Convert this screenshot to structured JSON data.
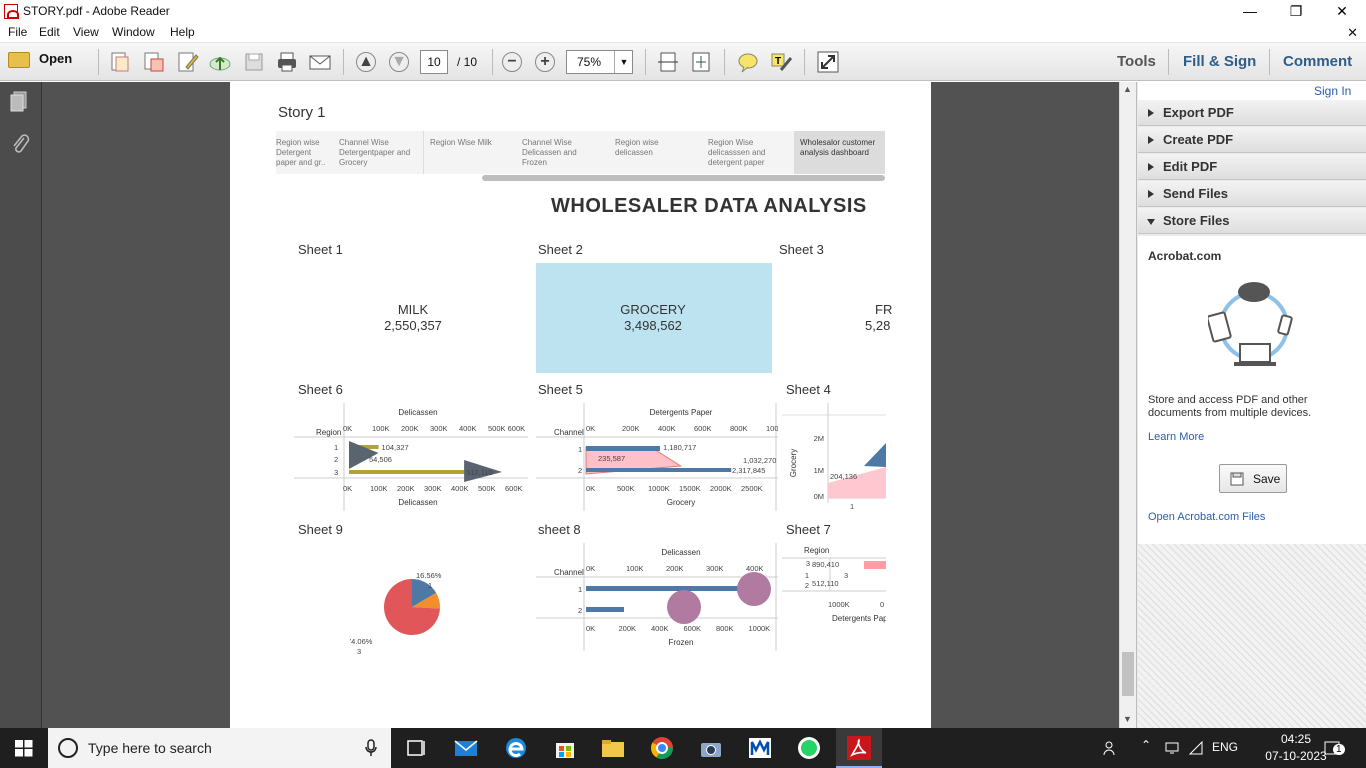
{
  "window": {
    "title": "STORY.pdf - Adobe Reader"
  },
  "menu": [
    "File",
    "Edit",
    "View",
    "Window",
    "Help"
  ],
  "toolbar": {
    "open_label": "Open",
    "page_current": "10",
    "page_total": "/ 10",
    "zoom": "75%",
    "tools": "Tools",
    "fill_sign": "Fill & Sign",
    "comment": "Comment"
  },
  "rightpane": {
    "sign_in": "Sign In",
    "sections": [
      "Export PDF",
      "Create PDF",
      "Edit PDF",
      "Send Files",
      "Store Files"
    ],
    "acrobat_title": "Acrobat.com",
    "description": "Store and access PDF and other documents from multiple devices.",
    "learn_more": "Learn More",
    "save_label": "Save",
    "open_files": "Open Acrobat.com Files"
  },
  "story": {
    "title": "Story 1",
    "tabs": [
      "Region wise Detergent paper and gr..",
      "Channel Wise Detergentpaper and Grocery",
      "Region Wise Milk",
      "Channel Wise Delicassen and Frozen",
      "Region wise delicassen",
      "Region Wise delicasssen and detergent paper",
      "Wholesalor customer analysis dashboard"
    ],
    "heading": "WHOLESALER DATA ANALYSIS",
    "sheets": {
      "s1": "Sheet 1",
      "s2": "Sheet 2",
      "s3": "Sheet 3",
      "s6": "Sheet 6",
      "s5": "Sheet 5",
      "s4": "Sheet 4",
      "s9": "Sheet 9",
      "s8": "sheet 8",
      "s7": "Sheet 7"
    },
    "kpis": [
      {
        "label": "MILK",
        "value": "2,550,357"
      },
      {
        "label": "GROCERY",
        "value": "3,498,562"
      },
      {
        "label": "FR",
        "value": "5,28"
      }
    ]
  },
  "chart_data": [
    {
      "name": "Sheet 6",
      "type": "bar",
      "title": "Delicassen",
      "xlabel": "Delicassen",
      "ylabel": "Region",
      "categories": [
        "1",
        "2",
        "3"
      ],
      "values": [
        104327,
        54506,
        512110
      ],
      "xticks_top": [
        "0K",
        "100K",
        "200K",
        "300K",
        "400K",
        "500K 600K"
      ],
      "xticks_bottom": [
        "0K",
        "100K",
        "200K",
        "300K",
        "400K",
        "500K",
        "600K"
      ],
      "labels": [
        "104,327",
        "54,506",
        "512,110"
      ],
      "color": "#b2a133"
    },
    {
      "name": "Sheet 5",
      "type": "bar",
      "title": "Detergents Paper",
      "xlabel": "Grocery",
      "ylabel": "Channel",
      "categories": [
        "1",
        "2"
      ],
      "series": [
        {
          "values": [
            1180717,
            2317845
          ],
          "color": "#4e79a7"
        },
        {
          "values": [
            235587,
            1032270
          ],
          "color": "#ff9da7"
        }
      ],
      "labels": [
        "1,180,717",
        "235,587",
        "1,032,270",
        "2,317,845"
      ],
      "xticks_top": [
        "0K",
        "200K",
        "400K",
        "600K",
        "800K",
        "1000K"
      ],
      "xticks_bottom": [
        "0K",
        "500K",
        "1000K",
        "1500K",
        "2000K",
        "2500K"
      ]
    },
    {
      "name": "Sheet 4",
      "type": "area",
      "ylabel": "Grocery",
      "categories": [
        "1"
      ],
      "yticks": [
        "2M",
        "1M",
        "0M"
      ],
      "labels": [
        "204,136"
      ]
    },
    {
      "name": "Sheet 9",
      "type": "pie",
      "slices": [
        {
          "label": "1",
          "percent": 16.56,
          "color": "#4e79a7"
        },
        {
          "label": "2",
          "percent": 9.38,
          "color": "#f28e2b"
        },
        {
          "label": "3",
          "percent": 74.06,
          "color": "#e15759"
        }
      ],
      "labels": [
        "16.56%",
        "1",
        "74.06%",
        "3"
      ]
    },
    {
      "name": "sheet 8",
      "type": "bar",
      "title": "Delicassen",
      "xlabel": "Frozen",
      "ylabel": "Channel",
      "categories": [
        "1",
        "2"
      ],
      "xticks_top": [
        "0K",
        "100K",
        "200K",
        "300K",
        "400K"
      ],
      "xticks_bottom": [
        "0K",
        "200K",
        "400K",
        "600K",
        "800K",
        "1000K"
      ]
    },
    {
      "name": "Sheet 7",
      "type": "bar",
      "ylabel": "Region",
      "xlabel": "Detergents Pap",
      "categories": [
        "3",
        "1",
        "2"
      ],
      "labels": [
        "890,410",
        "3",
        "512,110"
      ],
      "xticks_bottom": [
        "1000K",
        "0"
      ]
    }
  ],
  "taskbar": {
    "search_placeholder": "Type here to search",
    "lang": "ENG",
    "time": "04:25",
    "date": "07-10-2023",
    "notif": "1"
  }
}
